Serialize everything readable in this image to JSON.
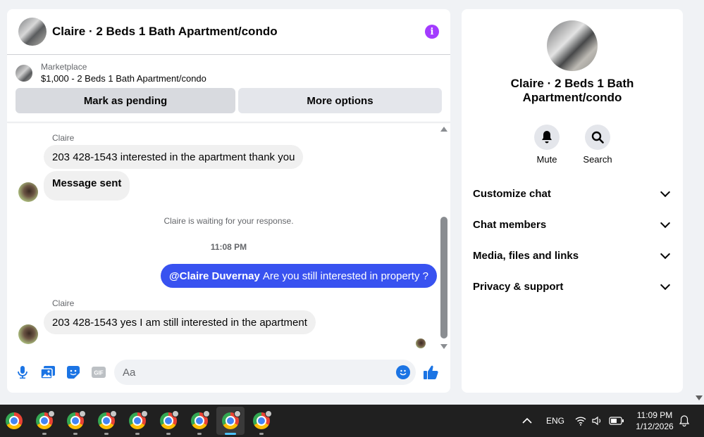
{
  "chat": {
    "title": "Claire · 2 Beds 1 Bath Apartment/condo",
    "listing": {
      "kind": "Marketplace",
      "price_title": "$1,000 - 2 Beds 1 Bath Apartment/condo",
      "pending_label": "Mark as pending",
      "more_label": "More options"
    },
    "messages": [
      {
        "sender": "Claire",
        "text": "203 428-1543 interested in the apartment thank you"
      },
      {
        "text": "Message sent"
      },
      {
        "system": "Claire is waiting for your response."
      },
      {
        "time": "11:08 PM"
      },
      {
        "mention": "@Claire Duvernay",
        "text": "Are you still interested in property ?"
      },
      {
        "sender": "Claire",
        "text": "203 428-1543 yes I am still interested in the apartment"
      }
    ],
    "composer_placeholder": "Aa",
    "composer_icons": [
      "microphone-icon",
      "photo-icon",
      "sticker-icon",
      "gif-icon",
      "emoji-icon",
      "thumbs-up-icon"
    ],
    "gif_label": "GIF"
  },
  "info": {
    "name": "Claire · 2 Beds 1 Bath Apartment/condo",
    "actions": [
      {
        "label": "Mute",
        "icon": "bell-icon"
      },
      {
        "label": "Search",
        "icon": "search-icon"
      }
    ],
    "menu": [
      {
        "label": "Customize chat"
      },
      {
        "label": "Chat members"
      },
      {
        "label": "Media, files and links"
      },
      {
        "label": "Privacy & support"
      }
    ]
  },
  "taskbar": {
    "apps": [
      "chrome",
      "chrome",
      "chrome",
      "chrome",
      "chrome",
      "chrome",
      "chrome",
      "chrome",
      "chrome"
    ],
    "active_index": 7,
    "lang": "ENG",
    "time": "11:09 PM",
    "date": "1/12/2026"
  },
  "colors": {
    "accent": "#3852f0",
    "messenger_blue": "#1b74e4",
    "info_purple": "#a33bff"
  }
}
